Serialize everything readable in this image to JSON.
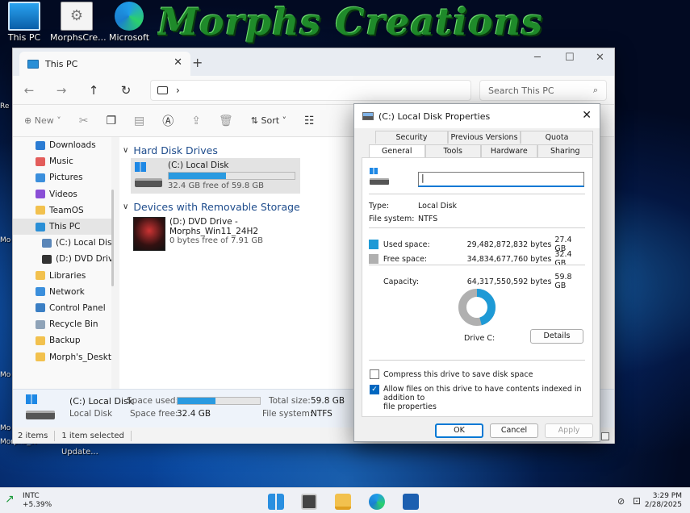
{
  "desktop": {
    "title_art": "Morphs Creations",
    "icons": [
      {
        "label": "This PC"
      },
      {
        "label": "MorphsCre..."
      },
      {
        "label": "Microsoft"
      }
    ],
    "left_stubs": [
      "Re",
      "Mo",
      "Mo",
      "Mo",
      "Morphs_W"
    ],
    "update_label": "Update..."
  },
  "explorer": {
    "tab_title": "This PC",
    "search_placeholder": "Search This PC",
    "toolbar": {
      "new_label": "New",
      "sort_label": "Sort"
    },
    "sidebar": [
      {
        "label": "Downloads",
        "color": "#2b7cd3"
      },
      {
        "label": "Music",
        "color": "#e35d5b"
      },
      {
        "label": "Pictures",
        "color": "#3b8fdc"
      },
      {
        "label": "Videos",
        "color": "#8a4fd6"
      },
      {
        "label": "TeamOS",
        "color": "#f2c14e"
      },
      {
        "label": "This PC",
        "color": "#2a8fd6",
        "selected": true
      },
      {
        "label": "(C:) Local Disk",
        "color": "#5a86b8",
        "sub": true
      },
      {
        "label": "(D:) DVD Drive",
        "color": "#333333",
        "sub": true
      },
      {
        "label": "Libraries",
        "color": "#f2c14e"
      },
      {
        "label": "Network",
        "color": "#3b8fdc"
      },
      {
        "label": "Control Panel",
        "color": "#3b7fc4"
      },
      {
        "label": "Recycle Bin",
        "color": "#8fa3b8"
      },
      {
        "label": "Backup",
        "color": "#f2c14e"
      },
      {
        "label": "Morph's_Deskto",
        "color": "#f2c14e"
      }
    ],
    "groups": {
      "hard_disk": "Hard Disk Drives",
      "removable": "Devices with Removable Storage"
    },
    "c_drive": {
      "name": "(C:) Local Disk",
      "free": "32.4 GB free of 59.8 GB",
      "used_fraction": 0.458
    },
    "d_drive": {
      "name_line1": "(D:) DVD Drive -",
      "name_line2": "Morphs_Win11_24H2",
      "free": "0 bytes free of 7.91 GB"
    },
    "details": {
      "name": "(C:) Local Disk",
      "type": "Local Disk",
      "space_used_label": "Space used:",
      "space_free_label": "Space free:",
      "space_free": "32.4 GB",
      "total_size_label": "Total size:",
      "total_size": "59.8 GB",
      "fs_label": "File system:",
      "fs": "NTFS",
      "used_fraction": 0.458
    },
    "status": {
      "items": "2 items",
      "selected": "1 item selected"
    }
  },
  "properties": {
    "title": "(C:) Local Disk Properties",
    "tabs_row1": [
      "Security",
      "Previous Versions",
      "Quota"
    ],
    "tabs_row2": [
      "General",
      "Tools",
      "Hardware",
      "Sharing"
    ],
    "type_label": "Type:",
    "type_value": "Local Disk",
    "fs_label": "File system:",
    "fs_value": "NTFS",
    "used_label": "Used space:",
    "used_bytes": "29,482,872,832 bytes",
    "used_gb": "27.4 GB",
    "free_label": "Free space:",
    "free_bytes": "34,834,677,760 bytes",
    "free_gb": "32.4 GB",
    "capacity_label": "Capacity:",
    "capacity_bytes": "64,317,550,592 bytes",
    "capacity_gb": "59.8 GB",
    "drive_label": "Drive C:",
    "details_btn": "Details",
    "compress_label": "Compress this drive to save disk space",
    "index_label_1": "Allow files on this drive to have contents indexed in addition to",
    "index_label_2": "file properties",
    "ok": "OK",
    "cancel": "Cancel",
    "apply": "Apply",
    "used_fraction": 0.458,
    "used_color": "#1e9ad6",
    "free_color": "#b0b0b0"
  },
  "taskbar": {
    "ticker_symbol": "INTC",
    "ticker_change": "+5.39%",
    "time": "3:29 PM",
    "date": "2/28/2025"
  }
}
